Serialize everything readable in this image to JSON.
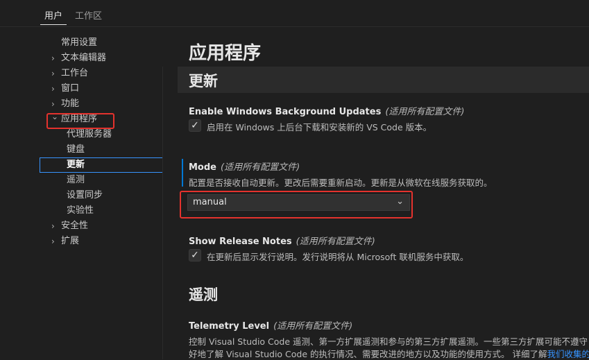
{
  "tabs": [
    {
      "label": "用户"
    },
    {
      "label": "工作区"
    }
  ],
  "toc": {
    "items": [
      {
        "label": "常用设置",
        "chevron": ""
      },
      {
        "label": "文本编辑器",
        "chevron": "›"
      },
      {
        "label": "工作台",
        "chevron": "›"
      },
      {
        "label": "窗口",
        "chevron": "›"
      },
      {
        "label": "功能",
        "chevron": "›"
      },
      {
        "label": "应用程序",
        "chevron": "⌄"
      },
      {
        "label": "代理服务器",
        "chevron": ""
      },
      {
        "label": "键盘",
        "chevron": ""
      },
      {
        "label": "更新",
        "chevron": ""
      },
      {
        "label": "遥测",
        "chevron": ""
      },
      {
        "label": "设置同步",
        "chevron": ""
      },
      {
        "label": "实验性",
        "chevron": ""
      },
      {
        "label": "安全性",
        "chevron": "›"
      },
      {
        "label": "扩展",
        "chevron": "›"
      }
    ]
  },
  "main": {
    "page_title": "应用程序",
    "section_update": "更新",
    "section_telemetry": "遥测",
    "settings": {
      "bg_updates": {
        "name": "Enable Windows Background Updates",
        "scope": "(适用所有配置文件)",
        "checkbox_label": "启用在 Windows 上后台下载和安装新的 VS Code 版本。",
        "checked": "✓"
      },
      "mode": {
        "name": "Mode",
        "scope": "(适用所有配置文件)",
        "description": "配置是否接收自动更新。更改后需要重新启动。更新是从微软在线服务获取的。",
        "value": "manual",
        "arrow": "⌄"
      },
      "release_notes": {
        "name": "Show Release Notes",
        "scope": "(适用所有配置文件)",
        "checkbox_label": "在更新后显示发行说明。发行说明将从 Microsoft 联机服务中获取。",
        "checked": "✓"
      },
      "telemetry": {
        "name": "Telemetry Level",
        "scope": "(适用所有配置文件)",
        "description_line1": "控制 Visual Studio Code 遥测、第一方扩展遥测和参与的第三方扩展遥测。一些第三方扩展可能不遵守",
        "description_line2": "好地了解 Visual Studio Code 的执行情况、需要改进的地方以及功能的使用方式。 详细了解",
        "link": "我们收集的"
      }
    }
  },
  "colors": {
    "background": "#1f1f1f",
    "accent": "#0078d4",
    "highlight": "#e5322d"
  }
}
